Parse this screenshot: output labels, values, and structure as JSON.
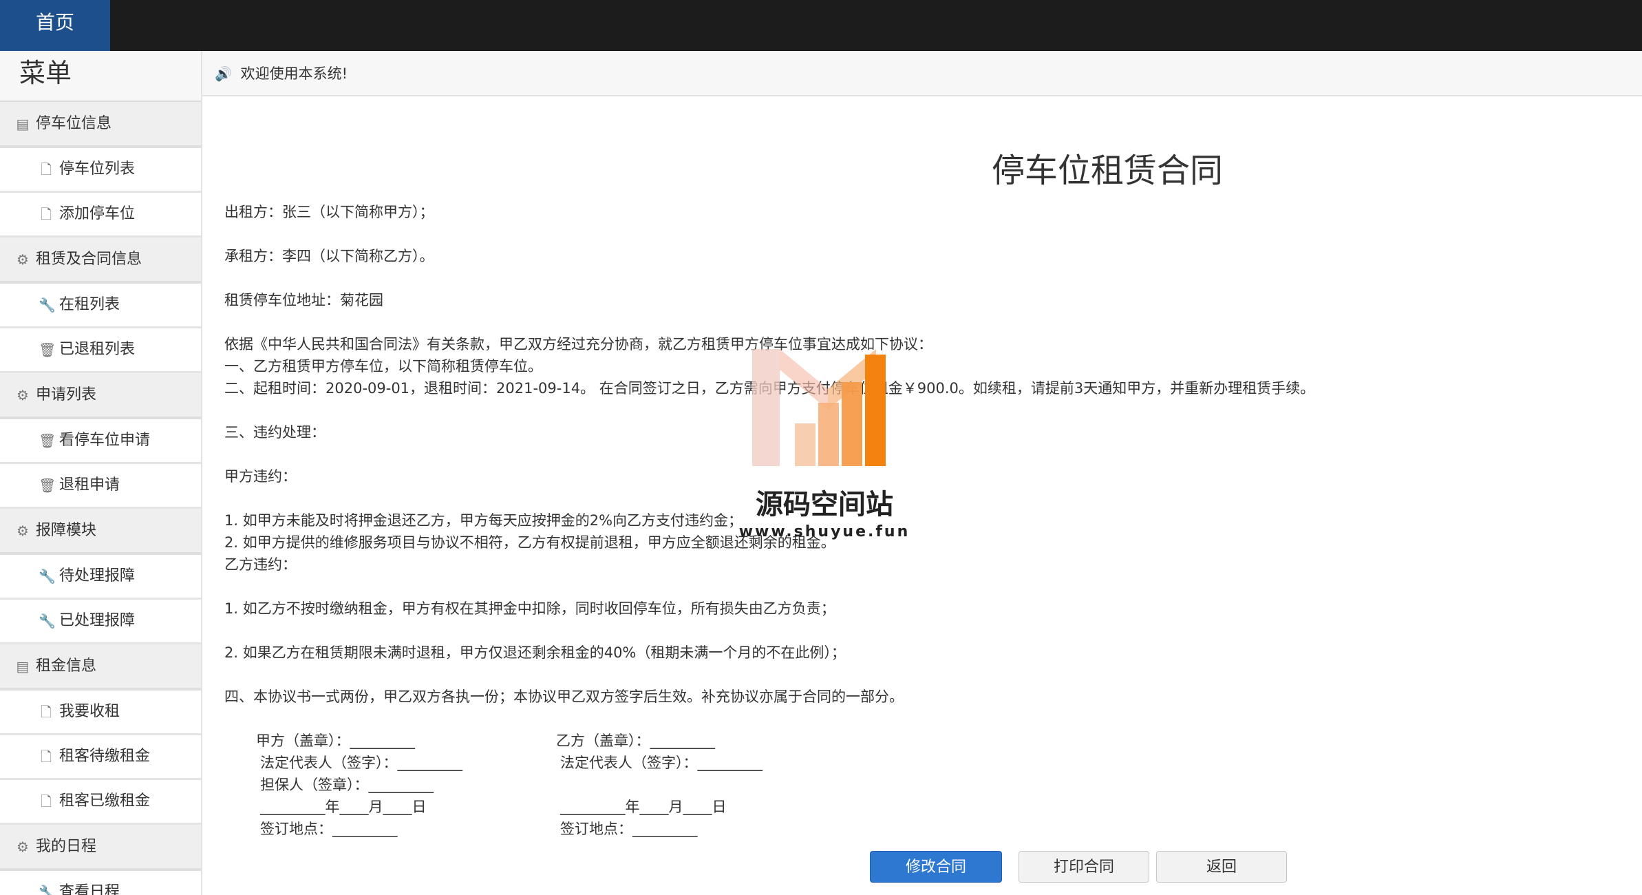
{
  "header": {
    "home_tab": "首页"
  },
  "sidebar": {
    "title": "菜单",
    "items": [
      {
        "type": "group",
        "label": "停车位信息",
        "icon": "list-icon"
      },
      {
        "type": "item",
        "label": "停车位列表",
        "icon": "file-icon"
      },
      {
        "type": "item",
        "label": "添加停车位",
        "icon": "file-icon"
      },
      {
        "type": "group",
        "label": "租赁及合同信息",
        "icon": "gear-icon"
      },
      {
        "type": "item",
        "label": "在租列表",
        "icon": "wrench-icon"
      },
      {
        "type": "item",
        "label": "已退租列表",
        "icon": "trash-icon"
      },
      {
        "type": "group",
        "label": "申请列表",
        "icon": "gear-icon"
      },
      {
        "type": "item",
        "label": "看停车位申请",
        "icon": "trash-icon"
      },
      {
        "type": "item",
        "label": "退租申请",
        "icon": "trash-icon"
      },
      {
        "type": "group",
        "label": "报障模块",
        "icon": "gear-icon"
      },
      {
        "type": "item",
        "label": "待处理报障",
        "icon": "wrench-icon"
      },
      {
        "type": "item",
        "label": "已处理报障",
        "icon": "wrench-icon"
      },
      {
        "type": "group",
        "label": "租金信息",
        "icon": "list-icon"
      },
      {
        "type": "item",
        "label": "我要收租",
        "icon": "file-icon"
      },
      {
        "type": "item",
        "label": "租客待缴租金",
        "icon": "file-icon"
      },
      {
        "type": "item",
        "label": "租客已缴租金",
        "icon": "file-icon"
      },
      {
        "type": "group",
        "label": "我的日程",
        "icon": "gear-icon"
      },
      {
        "type": "item",
        "label": "查看日程",
        "icon": "wrench-icon"
      }
    ]
  },
  "notice": {
    "text": "欢迎使用本系统!"
  },
  "contract": {
    "title": "停车位租赁合同",
    "lines": [
      "出租方：张三（以下简称甲方）；",
      "承租方：李四（以下简称乙方）。",
      "租赁停车位地址：菊花园",
      "依据《中华人民共和国合同法》有关条款，甲乙双方经过充分协商，就乙方租赁甲方停车位事宜达成如下协议：",
      "一、乙方租赁甲方停车位，以下简称租赁停车位。",
      "二、起租时间：2020-09-01，退租时间：2021-09-14。 在合同签订之日，乙方需向甲方支付停车位租金￥900.0。如续租，请提前3天通知甲方，并重新办理租赁手续。",
      "三、违约处理：",
      "甲方违约：",
      "1.  如甲方未能及时将押金退还乙方，甲方每天应按押金的2%向乙方支付违约金；",
      "2.  如甲方提供的维修服务项目与协议不相符，乙方有权提前退租，甲方应全额退还剩余的租金。",
      "乙方违约：",
      "1.  如乙方不按时缴纳租金，甲方有权在其押金中扣除，同时收回停车位，所有损失由乙方负责；",
      "2.  如果乙方在租赁期限未满时退租，甲方仅退还剩余租金的40%（租期未满一个月的不在此例）；",
      "四、本协议书一式两份，甲乙双方各执一份；本协议甲乙双方签字后生效。补充协议亦属于合同的一部分。"
    ],
    "signature_left": [
      "甲方（盖章）：_________",
      "法定代表人（签字）：_________",
      "担保人（签章）：_________",
      "_________年____月____日",
      "签订地点：_________"
    ],
    "signature_right": [
      "乙方（盖章）：_________",
      "法定代表人（签字）：_________",
      "_________年____月____日",
      "签订地点：_________"
    ]
  },
  "actions": {
    "modify": "修改合同",
    "print": "打印合同",
    "back": "返回"
  },
  "watermark": {
    "name": "源码空间站",
    "url": "www.shuyue.fun"
  },
  "colors": {
    "topbar": "#1c1c1c",
    "home_tab": "#1d4f8c",
    "primary_button": "#2f78d1"
  }
}
